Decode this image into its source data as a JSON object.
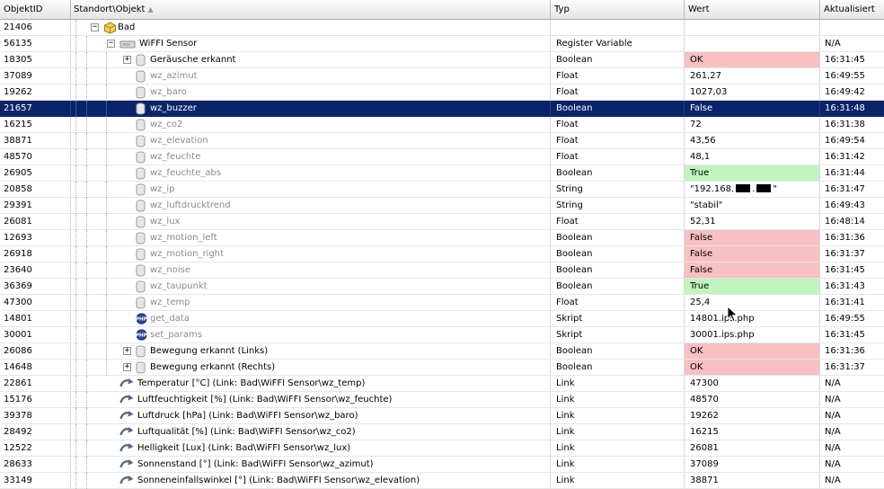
{
  "headers": {
    "id": "ObjektID",
    "object": "Standort\\Objekt",
    "type": "Typ",
    "value": "Wert",
    "updated": "Aktualisiert"
  },
  "rows": [
    {
      "id": "21406",
      "name": "Bad",
      "type": "",
      "value": "",
      "updated": "",
      "level": 1,
      "icon": "category",
      "expander": "minus",
      "dim": false,
      "color": ""
    },
    {
      "id": "56135",
      "name": "WiFFI Sensor",
      "type": "Register Variable",
      "value": "",
      "updated": "N/A",
      "level": 2,
      "icon": "instance",
      "expander": "minus",
      "dim": false,
      "color": ""
    },
    {
      "id": "18305",
      "name": "Geräusche erkannt",
      "type": "Boolean",
      "value": "OK",
      "updated": "16:31:45",
      "level": 3,
      "icon": "variable",
      "expander": "plus",
      "dim": false,
      "color": "red"
    },
    {
      "id": "37089",
      "name": "wz_azimut",
      "type": "Float",
      "value": "261,27",
      "updated": "16:49:55",
      "level": 3,
      "icon": "variable",
      "expander": "",
      "dim": true,
      "color": ""
    },
    {
      "id": "19262",
      "name": "wz_baro",
      "type": "Float",
      "value": "1027,03",
      "updated": "16:49:42",
      "level": 3,
      "icon": "variable",
      "expander": "",
      "dim": true,
      "color": ""
    },
    {
      "id": "21657",
      "name": "wz_buzzer",
      "type": "Boolean",
      "value": "False",
      "updated": "16:31:48",
      "level": 3,
      "icon": "variable",
      "expander": "",
      "dim": true,
      "color": "",
      "selected": true
    },
    {
      "id": "16215",
      "name": "wz_co2",
      "type": "Float",
      "value": "72",
      "updated": "16:31:38",
      "level": 3,
      "icon": "variable",
      "expander": "",
      "dim": true,
      "color": ""
    },
    {
      "id": "38871",
      "name": "wz_elevation",
      "type": "Float",
      "value": "43,56",
      "updated": "16:49:54",
      "level": 3,
      "icon": "variable",
      "expander": "",
      "dim": true,
      "color": ""
    },
    {
      "id": "48570",
      "name": "wz_feuchte",
      "type": "Float",
      "value": "48,1",
      "updated": "16:31:42",
      "level": 3,
      "icon": "variable",
      "expander": "",
      "dim": true,
      "color": ""
    },
    {
      "id": "26905",
      "name": "wz_feuchte_abs",
      "type": "Boolean",
      "value": "True",
      "updated": "16:31:44",
      "level": 3,
      "icon": "variable",
      "expander": "",
      "dim": true,
      "color": "green"
    },
    {
      "id": "20858",
      "name": "wz_ip",
      "type": "String",
      "value": "\"192.168.",
      "value_suffix": "\"",
      "masked": true,
      "updated": "16:31:47",
      "level": 3,
      "icon": "variable",
      "expander": "",
      "dim": true,
      "color": ""
    },
    {
      "id": "29391",
      "name": "wz_luftdrucktrend",
      "type": "String",
      "value": "\"stabil\"",
      "updated": "16:49:43",
      "level": 3,
      "icon": "variable",
      "expander": "",
      "dim": true,
      "color": ""
    },
    {
      "id": "26081",
      "name": "wz_lux",
      "type": "Float",
      "value": "52,31",
      "updated": "16:48:14",
      "level": 3,
      "icon": "variable",
      "expander": "",
      "dim": true,
      "color": ""
    },
    {
      "id": "12693",
      "name": "wz_motion_left",
      "type": "Boolean",
      "value": "False",
      "updated": "16:31:36",
      "level": 3,
      "icon": "variable",
      "expander": "",
      "dim": true,
      "color": "red"
    },
    {
      "id": "26918",
      "name": "wz_motion_right",
      "type": "Boolean",
      "value": "False",
      "updated": "16:31:37",
      "level": 3,
      "icon": "variable",
      "expander": "",
      "dim": true,
      "color": "red"
    },
    {
      "id": "23640",
      "name": "wz_noise",
      "type": "Boolean",
      "value": "False",
      "updated": "16:31:45",
      "level": 3,
      "icon": "variable",
      "expander": "",
      "dim": true,
      "color": "red"
    },
    {
      "id": "36369",
      "name": "wz_taupunkt",
      "type": "Boolean",
      "value": "True",
      "updated": "16:31:43",
      "level": 3,
      "icon": "variable",
      "expander": "",
      "dim": true,
      "color": "green"
    },
    {
      "id": "47300",
      "name": "wz_temp",
      "type": "Float",
      "value": "25,4",
      "updated": "16:31:41",
      "level": 3,
      "icon": "variable",
      "expander": "",
      "dim": true,
      "color": ""
    },
    {
      "id": "14801",
      "name": "get_data",
      "type": "Skript",
      "value": "14801.ips.php",
      "updated": "16:49:55",
      "level": 3,
      "icon": "script",
      "expander": "",
      "dim": true,
      "color": ""
    },
    {
      "id": "30001",
      "name": "set_params",
      "type": "Skript",
      "value": "30001.ips.php",
      "updated": "16:31:45",
      "level": 3,
      "icon": "script",
      "expander": "",
      "dim": true,
      "color": ""
    },
    {
      "id": "26086",
      "name": "Bewegung erkannt (Links)",
      "type": "Boolean",
      "value": "OK",
      "updated": "16:31:36",
      "level": 3,
      "icon": "variable",
      "expander": "plus",
      "dim": false,
      "color": "red"
    },
    {
      "id": "14648",
      "name": "Bewegung erkannt (Rechts)",
      "type": "Boolean",
      "value": "OK",
      "updated": "16:31:37",
      "level": 3,
      "icon": "variable",
      "expander": "plus",
      "dim": false,
      "color": "red"
    },
    {
      "id": "22861",
      "name": "Temperatur [°C] (Link: Bad\\WiFFI Sensor\\wz_temp)",
      "type": "Link",
      "value": "47300",
      "updated": "N/A",
      "level": 2,
      "icon": "link",
      "expander": "",
      "dim": false,
      "color": ""
    },
    {
      "id": "15176",
      "name": "Luftfeuchtigkeit [%] (Link: Bad\\WiFFI Sensor\\wz_feuchte)",
      "type": "Link",
      "value": "48570",
      "updated": "N/A",
      "level": 2,
      "icon": "link",
      "expander": "",
      "dim": false,
      "color": ""
    },
    {
      "id": "39378",
      "name": "Luftdruck [hPa] (Link: Bad\\WiFFI Sensor\\wz_baro)",
      "type": "Link",
      "value": "19262",
      "updated": "N/A",
      "level": 2,
      "icon": "link",
      "expander": "",
      "dim": false,
      "color": ""
    },
    {
      "id": "28492",
      "name": "Luftqualität [%] (Link: Bad\\WiFFI Sensor\\wz_co2)",
      "type": "Link",
      "value": "16215",
      "updated": "N/A",
      "level": 2,
      "icon": "link",
      "expander": "",
      "dim": false,
      "color": ""
    },
    {
      "id": "12522",
      "name": "Helligkeit [Lux] (Link: Bad\\WiFFI Sensor\\wz_lux)",
      "type": "Link",
      "value": "26081",
      "updated": "N/A",
      "level": 2,
      "icon": "link",
      "expander": "",
      "dim": false,
      "color": ""
    },
    {
      "id": "28633",
      "name": "Sonnenstand [°] (Link: Bad\\WiFFI Sensor\\wz_azimut)",
      "type": "Link",
      "value": "37089",
      "updated": "N/A",
      "level": 2,
      "icon": "link",
      "expander": "",
      "dim": false,
      "color": ""
    },
    {
      "id": "33149",
      "name": "Sonneneinfallswinkel [°] (Link: Bad\\WiFFI Sensor\\wz_elevation)",
      "type": "Link",
      "value": "38871",
      "updated": "N/A",
      "level": 2,
      "icon": "link",
      "expander": "",
      "dim": false,
      "color": ""
    }
  ],
  "colors": {
    "value_red": "#f8c0c0",
    "value_green": "#c0f5c0",
    "selection": "#0a246a"
  }
}
